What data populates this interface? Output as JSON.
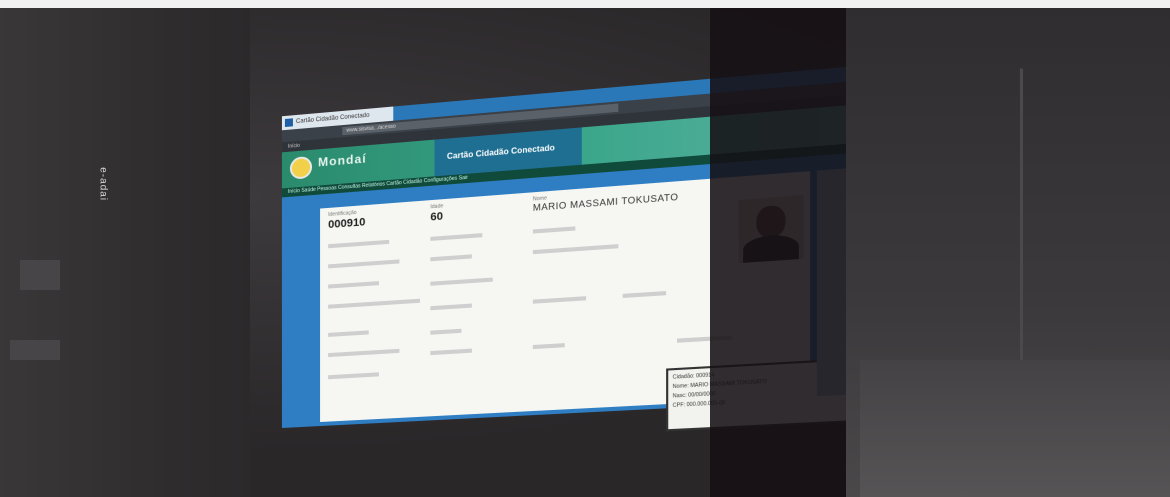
{
  "scene": {
    "side_text": "ᴉɐpɐ‑ǝ",
    "colors": {
      "wall": "#2e2b2d",
      "screen_blue": "#2f7ec4",
      "banner_green": "#2a8a6c",
      "card": "#f6f7f2"
    }
  },
  "browser": {
    "tab_title": "Cartão Cidadão Conectado",
    "address": "www.sisvisa.../acesso",
    "bookmarks": "Início"
  },
  "app": {
    "city_name": "Mondaí",
    "title": "Cartão Cidadão Conectado",
    "menu": "Início   Saúde   Pessoas   Consultas   Relatórios   Cartão Cidadão   Configurações   Sair"
  },
  "record": {
    "code_label": "Identificação",
    "code": "000910",
    "age_label": "Idade",
    "age": "60",
    "name_label": "Nome",
    "name": "MARIO MASSAMI TOKUSATO"
  },
  "popup": {
    "line1": "Cidadão: 000914",
    "line2": "Nome: MARIO MASSAMI TOKUSATO",
    "line3": "Nasc: 00/00/0000",
    "line4": "CPF: 000.000.000-00"
  }
}
